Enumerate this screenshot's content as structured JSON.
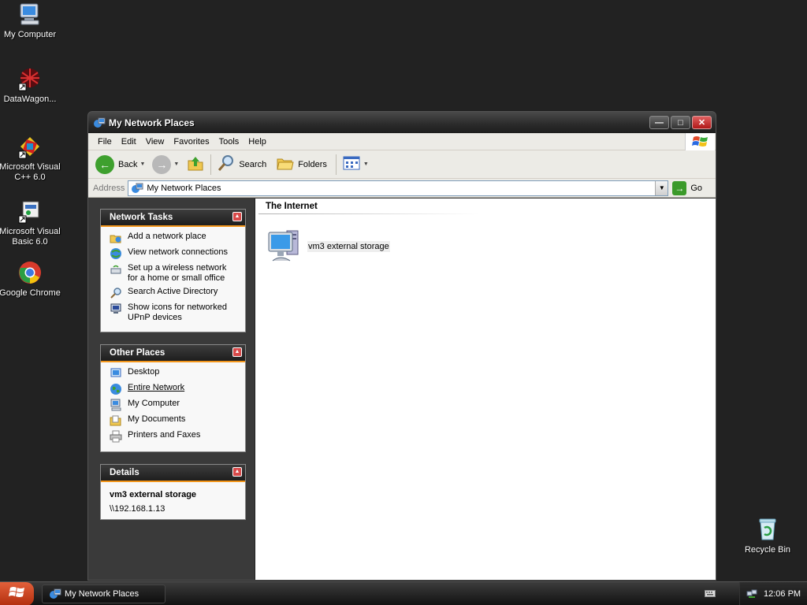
{
  "desktop": {
    "icons": [
      {
        "label": "My Computer"
      },
      {
        "label": "DataWagon..."
      },
      {
        "label": "Microsoft Visual C++ 6.0"
      },
      {
        "label": "Microsoft Visual Basic 6.0"
      },
      {
        "label": "Google Chrome"
      },
      {
        "label": "Recycle Bin"
      }
    ]
  },
  "window": {
    "title": "My Network Places",
    "menu": [
      "File",
      "Edit",
      "View",
      "Favorites",
      "Tools",
      "Help"
    ],
    "toolbar": {
      "back": "Back",
      "search": "Search",
      "folders": "Folders"
    },
    "address": {
      "label": "Address",
      "value": "My Network Places",
      "go": "Go"
    },
    "panels": {
      "network_tasks": {
        "title": "Network Tasks",
        "items": [
          {
            "label": "Add a network place"
          },
          {
            "label": "View network connections"
          },
          {
            "label": "Set up a wireless network for a home or small office"
          },
          {
            "label": "Search Active Directory"
          },
          {
            "label": "Show icons for networked UPnP devices"
          }
        ]
      },
      "other_places": {
        "title": "Other Places",
        "items": [
          {
            "label": "Desktop"
          },
          {
            "label": "Entire Network"
          },
          {
            "label": "My Computer"
          },
          {
            "label": "My Documents"
          },
          {
            "label": "Printers and Faxes"
          }
        ]
      },
      "details": {
        "title": "Details",
        "name": "vm3 external storage",
        "path": "\\\\192.168.1.13"
      }
    },
    "main": {
      "group": "The Internet",
      "items": [
        {
          "label": "vm3 external storage"
        }
      ]
    }
  },
  "taskbar": {
    "items": [
      {
        "label": "My Network Places"
      }
    ],
    "clock": "12:06 PM"
  },
  "colors": {
    "desktop_bg": "#222222",
    "panel_accent": "#f2951a",
    "start_button": "#c8401a"
  }
}
